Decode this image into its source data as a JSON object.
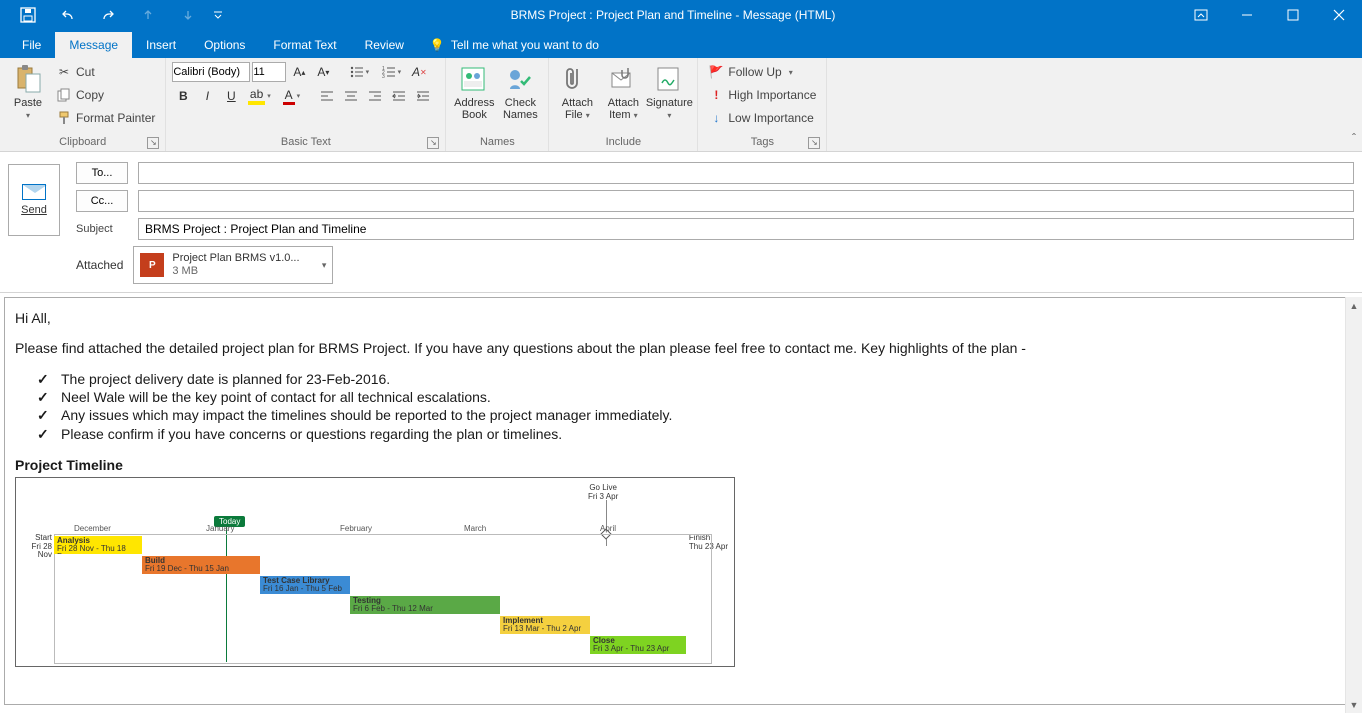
{
  "window": {
    "title": "BRMS Project : Project Plan and Timeline - Message (HTML)"
  },
  "qat": {
    "save": "save",
    "undo": "undo",
    "redo": "redo",
    "prev": "prev",
    "next": "next",
    "more": "more"
  },
  "tabs": {
    "file": "File",
    "message": "Message",
    "insert": "Insert",
    "options": "Options",
    "format_text": "Format Text",
    "review": "Review",
    "tellme": "Tell me what you want to do"
  },
  "ribbon": {
    "clipboard": {
      "label": "Clipboard",
      "paste": "Paste",
      "cut": "Cut",
      "copy": "Copy",
      "format_painter": "Format Painter"
    },
    "basic_text": {
      "label": "Basic Text",
      "font_name": "Calibri (Body)",
      "font_size": "11"
    },
    "names": {
      "label": "Names",
      "address_book": "Address Book",
      "check_names": "Check Names"
    },
    "include": {
      "label": "Include",
      "attach_file": "Attach File",
      "attach_item": "Attach Item",
      "signature": "Signature"
    },
    "tags": {
      "label": "Tags",
      "follow_up": "Follow Up",
      "high": "High Importance",
      "low": "Low Importance"
    }
  },
  "compose": {
    "send": "Send",
    "to_label": "To...",
    "cc_label": "Cc...",
    "subject_label": "Subject",
    "attached_label": "Attached",
    "to": "",
    "cc": "",
    "subject": "BRMS Project : Project Plan and Timeline",
    "attachment": {
      "name": "Project Plan BRMS v1.0...",
      "size": "3 MB"
    }
  },
  "body": {
    "greeting": "Hi All,",
    "intro": "Please find attached the detailed project plan for BRMS Project. If you have any questions about the plan please feel free to contact me. Key highlights of the plan -",
    "bullets": [
      "The project delivery date is planned for 23-Feb-2016.",
      "Neel Wale will be the key point of contact for all technical escalations.",
      "Any issues which may impact the timelines should be reported to the project manager immediately.",
      "Please confirm if you have concerns or questions regarding the plan or timelines."
    ],
    "section_title": "Project Timeline"
  },
  "chart_data": {
    "type": "bar",
    "title": "Project Timeline",
    "milestone": {
      "label": "Go Live",
      "date": "Fri 3 Apr"
    },
    "today_label": "Today",
    "start": {
      "label": "Start",
      "date": "Fri 28 Nov"
    },
    "finish": {
      "label": "Finish",
      "date": "Thu 23 Apr"
    },
    "months": [
      "December",
      "January",
      "February",
      "March",
      "April"
    ],
    "series": [
      {
        "name": "Analysis",
        "range": "Fri 28 Nov - Thu 18 Dec",
        "color": "c-yel"
      },
      {
        "name": "Build",
        "range": "Fri 19 Dec - Thu 15 Jan",
        "color": "c-org"
      },
      {
        "name": "Test Case Library",
        "range": "Fri 16 Jan - Thu 5 Feb",
        "color": "c-blu"
      },
      {
        "name": "Testing",
        "range": "Fri 6 Feb - Thu 12 Mar",
        "color": "c-grn"
      },
      {
        "name": "Implement",
        "range": "Fri 13 Mar - Thu 2 Apr",
        "color": "c-yl2"
      },
      {
        "name": "Close",
        "range": "Fri 3 Apr - Thu 23 Apr",
        "color": "c-lim"
      }
    ]
  }
}
